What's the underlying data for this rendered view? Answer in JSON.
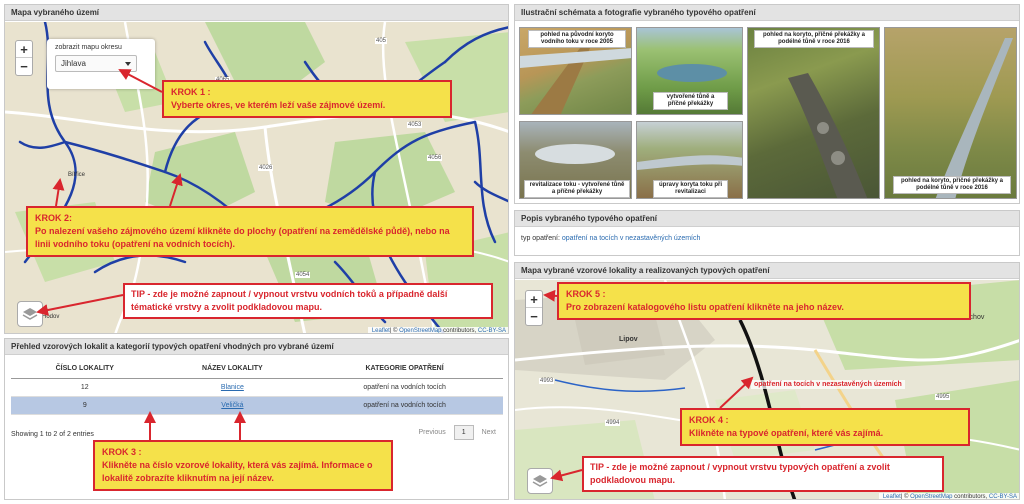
{
  "map_panel": {
    "title": "Mapa vybraného území",
    "district_label": "zobrazit mapu okresu",
    "district_value": "Jihlava",
    "towns": [
      "Bítřice",
      "Luka nad Jihlavou",
      "Hodov",
      "Zhoř",
      "Vysoké Studnice"
    ],
    "road_numbers": [
      "4065",
      "4026",
      "405",
      "4056",
      "4023",
      "4053",
      "4054"
    ],
    "attribution": {
      "leaflet": "Leaflet",
      "osm_prefix": "| © ",
      "osm": "OpenStreetMap",
      "contributors": " contributors, ",
      "license": "CC-BY-SA"
    }
  },
  "table_panel": {
    "title": "Přehled vzorových lokalit a kategorií typových opatření vhodných pro vybrané území",
    "columns": [
      "ČÍSLO LOKALITY",
      "NÁZEV LOKALITY",
      "KATEGORIE OPATŘENÍ"
    ],
    "rows": [
      {
        "number": "12",
        "name": "Blanice",
        "category": "opatření na vodních tocích"
      },
      {
        "number": "9",
        "name": "Veličká",
        "category": "opatření na vodních tocích"
      }
    ],
    "info": "Showing 1 to 2 of 2 entries",
    "pagination": {
      "previous": "Previous",
      "page": "1",
      "next": "Next"
    }
  },
  "photos_panel": {
    "title": "Ilustrační schémata a fotografie vybraného typového opatření",
    "captions": [
      "pohled na původní koryto vodního toku v roce 2005",
      "vytvořené tůně a příčné překážky",
      "pohled na koryto, příčné překážky a podélné tůně v roce 2016",
      "revitalizace toku - vytvořené tůně a příčné překážky",
      "úpravy koryta toku při revitalizaci",
      "pohled na koryto, příčné překážky a podélné tůně v roce 2016"
    ]
  },
  "description_panel": {
    "title": "Popis vybraného typového opatření",
    "label": "typ opatření: ",
    "value": "opatření na tocích v nezastavěných územích"
  },
  "locality_map": {
    "title": "Mapa vybrané vzorové lokality a realizovaných typových opatření",
    "towns": [
      "Lipov",
      "Suchov"
    ],
    "road_numbers": [
      "4992",
      "4993",
      "4994",
      "4995"
    ],
    "popup": "opatření na tocích v nezastavěných územích",
    "attribution": {
      "leaflet": "Leaflet",
      "osm_prefix": "| © ",
      "osm": "OpenStreetMap",
      "contributors": " contributors, ",
      "license": "CC-BY-SA"
    }
  },
  "callouts": {
    "krok1_title": "KROK 1 :",
    "krok1_text": "Vyberte okres, ve kterém leží vaše zájmové území.",
    "krok2_title": "KROK 2:",
    "krok2_text": "Po nalezení vašeho zájmového území klikněte do plochy (opatření na zemědělské půdě), nebo na linii vodního toku (opatření na vodních tocích).",
    "tip1": "TIP - zde je možné zapnout / vypnout vrstvu vodních toků a případně další tématické vrstvy a zvolit podkladovou mapu.",
    "krok3_title": "KROK 3 :",
    "krok3_text": "Klikněte na číslo vzorové lokality, která vás zajímá. Informace o lokalitě zobrazíte kliknutím na její název.",
    "krok4_title": "KROK 4 :",
    "krok4_text": "Klikněte na typové opatření, které vás zajímá.",
    "krok5_title": "KROK 5 :",
    "krok5_text": "Pro zobrazení katalogového listu opatření klikněte na jeho název.",
    "tip2": "TIP - zde je možné zapnout / vypnout vrstvu typových opatření a zvolit podkladovou mapu."
  },
  "colors": {
    "callout_fill": "#f5e14a",
    "callout_border": "#d9262e",
    "river": "#1f3fa6",
    "selected_row": "#b7c8e3"
  }
}
